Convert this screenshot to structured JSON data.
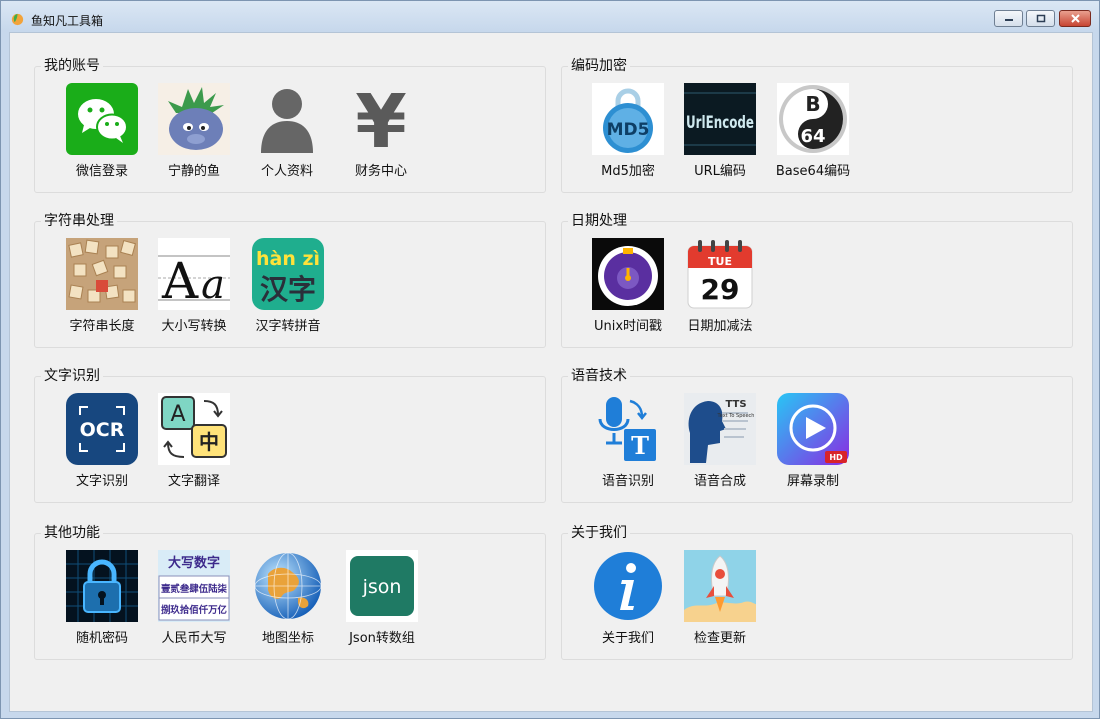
{
  "window": {
    "title": "鱼知凡工具箱"
  },
  "groups": {
    "account": {
      "title": "我的账号",
      "tools": [
        "微信登录",
        "宁静的鱼",
        "个人资料",
        "财务中心"
      ]
    },
    "encode": {
      "title": "编码加密",
      "tools": [
        "Md5加密",
        "URL编码",
        "Base64编码"
      ]
    },
    "string": {
      "title": "字符串处理",
      "tools": [
        "字符串长度",
        "大小写转换",
        "汉字转拼音"
      ]
    },
    "date": {
      "title": "日期处理",
      "tools": [
        "Unix时间戳",
        "日期加减法"
      ]
    },
    "ocr": {
      "title": "文字识别",
      "tools": [
        "文字识别",
        "文字翻译"
      ]
    },
    "voice": {
      "title": "语音技术",
      "tools": [
        "语音识别",
        "语音合成",
        "屏幕录制"
      ]
    },
    "other": {
      "title": "其他功能",
      "tools": [
        "随机密码",
        "人民币大写",
        "地图坐标",
        "Json转数组"
      ]
    },
    "about": {
      "title": "关于我们",
      "tools": [
        "关于我们",
        "检查更新"
      ]
    }
  },
  "icon_text": {
    "md5": "MD5",
    "url": "UrlEncode",
    "b64_top": "B",
    "b64_bottom": "64",
    "pinyin_top": "hàn zì",
    "pinyin_bottom": "汉字",
    "calendar_day": "TUE",
    "calendar_date": "29",
    "ocr": "OCR",
    "translate_a": "A",
    "translate_zh": "中",
    "tts": "TTS",
    "tts_sub": "Text To Speech",
    "hd": "HD",
    "rmb_title": "大写数字",
    "rmb_row1": "壹贰叁肆伍陆柒",
    "rmb_row2": "捌玖拾佰仟万亿",
    "json": "json",
    "yen": "¥",
    "case_a1": "A",
    "case_a2": "a"
  },
  "colors": {
    "wechat": "#1aad19",
    "accent_blue": "#1f7ed8",
    "json_bg": "#1f7a64"
  }
}
